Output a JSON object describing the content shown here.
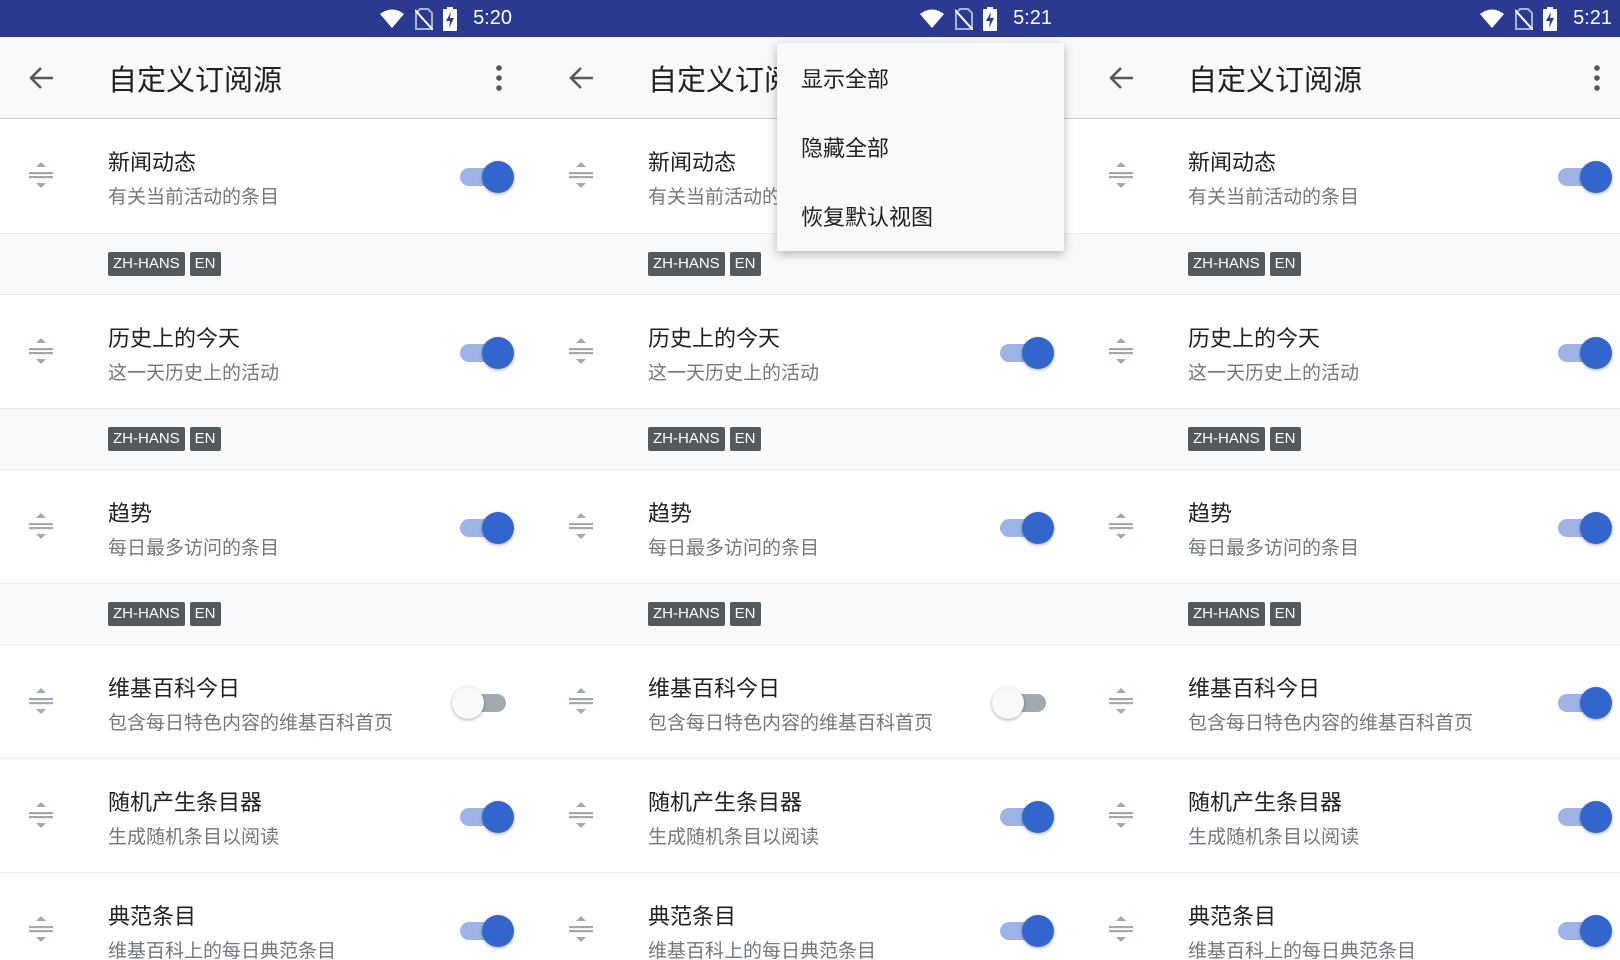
{
  "theme": {
    "statusbar": "#2b3a8f",
    "accent": "#3366cc",
    "appbar": "#f8f9fa"
  },
  "screens": [
    {
      "status_time": "5:20",
      "title": "自定义订阅源",
      "feeds": [
        {
          "title": "新闻动态",
          "desc": "有关当前活动的条目",
          "enabled": true,
          "langs": [
            "ZH-HANS",
            "EN"
          ]
        },
        {
          "title": "历史上的今天",
          "desc": "这一天历史上的活动",
          "enabled": true,
          "langs": [
            "ZH-HANS",
            "EN"
          ]
        },
        {
          "title": "趋势",
          "desc": "每日最多访问的条目",
          "enabled": true,
          "langs": [
            "ZH-HANS",
            "EN"
          ]
        },
        {
          "title": "维基百科今日",
          "desc": "包含每日特色内容的维基百科首页",
          "enabled": false
        },
        {
          "title": "随机产生条目器",
          "desc": "生成随机条目以阅读",
          "enabled": true
        },
        {
          "title": "典范条目",
          "desc": "维基百科上的每日典范条目",
          "enabled": true
        }
      ]
    },
    {
      "status_time": "5:21",
      "title": "自定义订阅源",
      "menu": [
        "显示全部",
        "隐藏全部",
        "恢复默认视图"
      ],
      "feeds": [
        {
          "title": "新闻动态",
          "desc": "有关当前活动的条目",
          "enabled": true,
          "langs": [
            "ZH-HANS",
            "EN"
          ]
        },
        {
          "title": "历史上的今天",
          "desc": "这一天历史上的活动",
          "enabled": true,
          "langs": [
            "ZH-HANS",
            "EN"
          ]
        },
        {
          "title": "趋势",
          "desc": "每日最多访问的条目",
          "enabled": true,
          "langs": [
            "ZH-HANS",
            "EN"
          ]
        },
        {
          "title": "维基百科今日",
          "desc": "包含每日特色内容的维基百科首页",
          "enabled": false
        },
        {
          "title": "随机产生条目器",
          "desc": "生成随机条目以阅读",
          "enabled": true
        },
        {
          "title": "典范条目",
          "desc": "维基百科上的每日典范条目",
          "enabled": true
        }
      ]
    },
    {
      "status_time": "5:21",
      "title": "自定义订阅源",
      "feeds": [
        {
          "title": "新闻动态",
          "desc": "有关当前活动的条目",
          "enabled": true,
          "langs": [
            "ZH-HANS",
            "EN"
          ]
        },
        {
          "title": "历史上的今天",
          "desc": "这一天历史上的活动",
          "enabled": true,
          "langs": [
            "ZH-HANS",
            "EN"
          ]
        },
        {
          "title": "趋势",
          "desc": "每日最多访问的条目",
          "enabled": true,
          "langs": [
            "ZH-HANS",
            "EN"
          ]
        },
        {
          "title": "维基百科今日",
          "desc": "包含每日特色内容的维基百科首页",
          "enabled": true
        },
        {
          "title": "随机产生条目器",
          "desc": "生成随机条目以阅读",
          "enabled": true
        },
        {
          "title": "典范条目",
          "desc": "维基百科上的每日典范条目",
          "enabled": true
        }
      ]
    }
  ]
}
